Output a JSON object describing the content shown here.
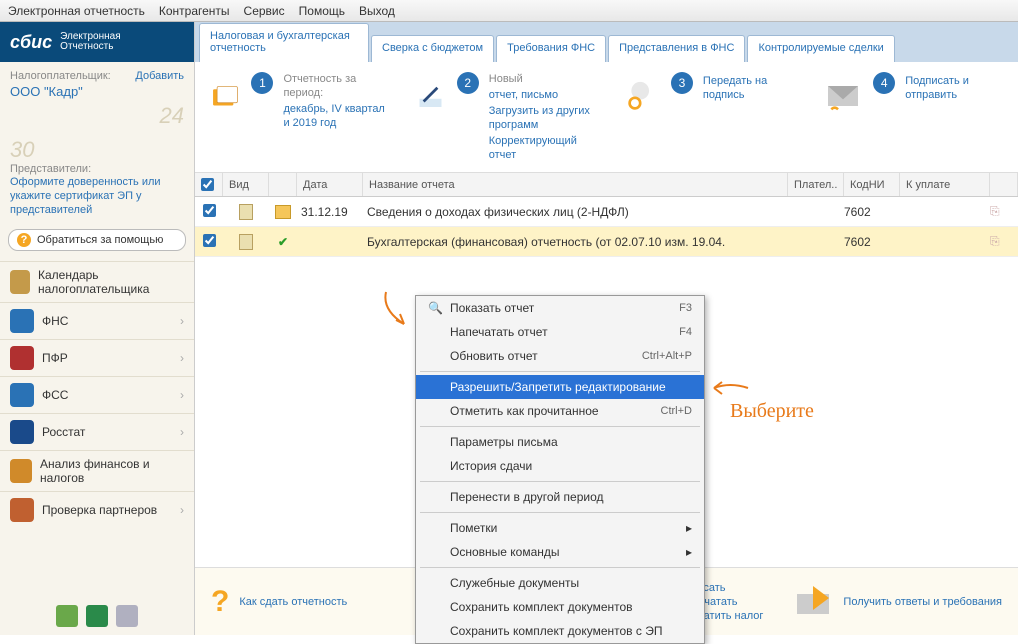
{
  "menubar": [
    "Электронная отчетность",
    "Контрагенты",
    "Сервис",
    "Помощь",
    "Выход"
  ],
  "logo": {
    "brand": "сбис",
    "sub1": "Электронная",
    "sub2": "Отчетность"
  },
  "payer": {
    "label": "Налогоплательщик:",
    "add": "Добавить",
    "org": "ООО \"Кадр\""
  },
  "deco": {
    "n24": "24",
    "n30": "30"
  },
  "reps": {
    "label": "Представители:",
    "link": "Оформите доверенность или укажите сертификат ЭП у представителей"
  },
  "help_btn": "Обратиться за помощью",
  "nav": [
    {
      "label": "Календарь налогоплательщика",
      "cls": "ni-cal"
    },
    {
      "label": "ФНС",
      "cls": "ni-fns",
      "chev": true
    },
    {
      "label": "ПФР",
      "cls": "ni-pfr",
      "chev": true
    },
    {
      "label": "ФСС",
      "cls": "ni-fss",
      "chev": true
    },
    {
      "label": "Росстат",
      "cls": "ni-ros",
      "chev": true
    },
    {
      "label": "Анализ финансов и налогов",
      "cls": "ni-fin"
    },
    {
      "label": "Проверка партнеров",
      "cls": "ni-chk",
      "chev": true
    }
  ],
  "tabs": [
    "Налоговая и бухгалтерская отчетность",
    "Сверка с бюджетом",
    "Требования ФНС",
    "Представления в ФНС",
    "Контролируемые сделки"
  ],
  "steps": [
    {
      "num": "1",
      "title": "Отчетность за период:",
      "lines": [
        "декабрь, IV квартал и 2019 год"
      ]
    },
    {
      "num": "2",
      "title": "Новый",
      "lines": [
        "отчет, письмо",
        "Загрузить из других программ",
        "Корректирующий отчет"
      ]
    },
    {
      "num": "3",
      "title": "",
      "lines": [
        "Передать на подпись"
      ]
    },
    {
      "num": "4",
      "title": "",
      "lines": [
        "Подписать и отправить"
      ]
    }
  ],
  "grid": {
    "headers": {
      "kind": "Вид",
      "date": "Дата",
      "name": "Название отчета",
      "pay": "Плател..",
      "kni": "КодНИ",
      "sum": "К уплате"
    },
    "rows": [
      {
        "date": "31.12.19",
        "name": "Сведения о доходах физических лиц (2-НДФЛ)",
        "kni": "7602",
        "status": "folder"
      },
      {
        "date": "",
        "name": "Бухгалтерская (финансовая) отчетность (от 02.07.10 изм. 19.04.",
        "kni": "7602",
        "status": "check",
        "sel": true
      }
    ]
  },
  "context_menu": [
    {
      "label": "Показать отчет",
      "sc": "F3",
      "ico": true
    },
    {
      "label": "Напечатать отчет",
      "sc": "F4"
    },
    {
      "label": "Обновить отчет",
      "sc": "Ctrl+Alt+P"
    },
    {
      "sep": true
    },
    {
      "label": "Разрешить/Запретить редактирование",
      "hl": true
    },
    {
      "label": "Отметить как прочитанное",
      "sc": "Ctrl+D"
    },
    {
      "sep": true
    },
    {
      "label": "Параметры письма"
    },
    {
      "label": "История сдачи"
    },
    {
      "sep": true
    },
    {
      "label": "Перенести в другой период"
    },
    {
      "sep": true
    },
    {
      "label": "Пометки",
      "sub": true
    },
    {
      "label": "Основные команды",
      "sub": true
    },
    {
      "sep": true
    },
    {
      "label": "Служебные документы"
    },
    {
      "label": "Сохранить комплект документов"
    },
    {
      "label": "Сохранить комплект документов с ЭП"
    }
  ],
  "callout": "Выберите",
  "bottom": {
    "howto": "Как сдать отчетность",
    "center": [
      "Записать",
      "Напечатать",
      "Заплатить налог"
    ],
    "right": "Получить ответы и требования"
  }
}
